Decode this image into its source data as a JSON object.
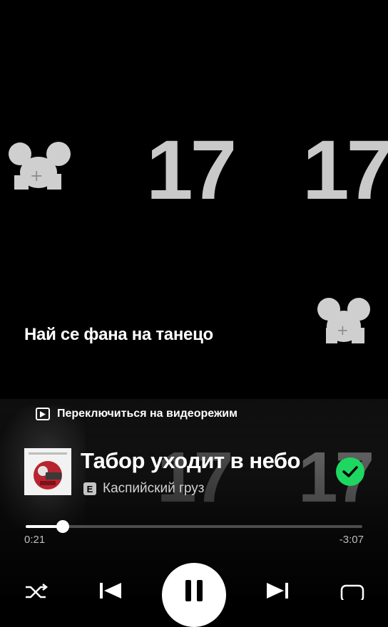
{
  "canvas": {
    "big_numbers": [
      "17",
      "17",
      "17"
    ],
    "lyric_line": "Най се фана на танецо"
  },
  "video_switch": {
    "label": "Переключиться на видеорежим",
    "icon": "play-box-icon"
  },
  "track": {
    "title": "Табор уходит в небо",
    "explicit_badge": "E",
    "artist": "Каспийский груз",
    "liked": true
  },
  "playback": {
    "elapsed": "0:21",
    "remaining": "-3:07",
    "progress_fraction": 0.11,
    "state": "playing"
  },
  "controls": {
    "shuffle_icon": "shuffle-icon",
    "previous_icon": "skip-previous-icon",
    "pause_icon": "pause-icon",
    "next_icon": "skip-next-icon",
    "repeat_icon": "repeat-icon"
  },
  "colors": {
    "background": "#000000",
    "accent_green": "#1ed760",
    "numbers_gray": "#c9c9c9"
  }
}
